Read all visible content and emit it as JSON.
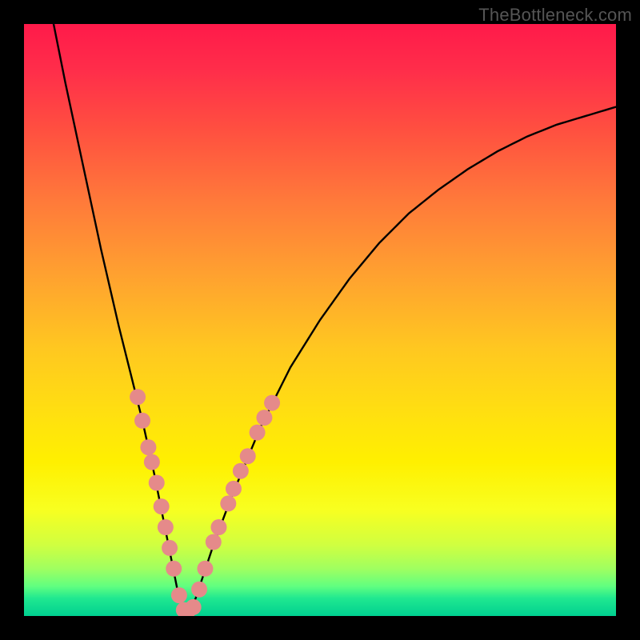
{
  "watermark": "TheBottleneck.com",
  "chart_data": {
    "type": "line",
    "title": "",
    "xlabel": "",
    "ylabel": "",
    "xlim": [
      0,
      100
    ],
    "ylim": [
      0,
      100
    ],
    "curve": {
      "name": "bottleneck-curve",
      "description": "V-shaped bottleneck curve with minimum near x≈27",
      "points_x": [
        5,
        7,
        10,
        13,
        16,
        18,
        20,
        22,
        24,
        25,
        26,
        27,
        28,
        29,
        30,
        32,
        35,
        40,
        45,
        50,
        55,
        60,
        65,
        70,
        75,
        80,
        85,
        90,
        95,
        100
      ],
      "points_y": [
        100,
        90,
        76,
        62,
        49,
        41,
        33,
        24,
        14,
        9,
        4,
        1,
        1,
        3,
        6,
        12,
        20,
        32,
        42,
        50,
        57,
        63,
        68,
        72,
        75.5,
        78.5,
        81,
        83,
        84.5,
        86
      ]
    },
    "markers": {
      "color": "#e58a8a",
      "radius": 10,
      "points": [
        {
          "x": 19.2,
          "y": 37
        },
        {
          "x": 20.0,
          "y": 33
        },
        {
          "x": 21.0,
          "y": 28.5
        },
        {
          "x": 21.6,
          "y": 26
        },
        {
          "x": 22.4,
          "y": 22.5
        },
        {
          "x": 23.2,
          "y": 18.5
        },
        {
          "x": 23.9,
          "y": 15
        },
        {
          "x": 24.6,
          "y": 11.5
        },
        {
          "x": 25.3,
          "y": 8
        },
        {
          "x": 26.2,
          "y": 3.5
        },
        {
          "x": 27.0,
          "y": 1
        },
        {
          "x": 27.8,
          "y": 1
        },
        {
          "x": 28.6,
          "y": 1.5
        },
        {
          "x": 29.6,
          "y": 4.5
        },
        {
          "x": 30.6,
          "y": 8
        },
        {
          "x": 32.0,
          "y": 12.5
        },
        {
          "x": 32.9,
          "y": 15
        },
        {
          "x": 34.5,
          "y": 19
        },
        {
          "x": 35.4,
          "y": 21.5
        },
        {
          "x": 36.6,
          "y": 24.5
        },
        {
          "x": 37.8,
          "y": 27
        },
        {
          "x": 39.4,
          "y": 31
        },
        {
          "x": 40.6,
          "y": 33.5
        },
        {
          "x": 41.9,
          "y": 36
        }
      ]
    },
    "gradient_stops": [
      {
        "pos": 0,
        "color": "#ff1a4a"
      },
      {
        "pos": 8,
        "color": "#ff2e4a"
      },
      {
        "pos": 18,
        "color": "#ff5040"
      },
      {
        "pos": 30,
        "color": "#ff7a3a"
      },
      {
        "pos": 42,
        "color": "#ffa030"
      },
      {
        "pos": 55,
        "color": "#ffc820"
      },
      {
        "pos": 66,
        "color": "#ffe010"
      },
      {
        "pos": 74,
        "color": "#fff000"
      },
      {
        "pos": 82,
        "color": "#f8ff20"
      },
      {
        "pos": 88,
        "color": "#d0ff40"
      },
      {
        "pos": 92,
        "color": "#a0ff60"
      },
      {
        "pos": 95,
        "color": "#60ff80"
      },
      {
        "pos": 97,
        "color": "#20e890"
      },
      {
        "pos": 100,
        "color": "#00d090"
      }
    ]
  }
}
